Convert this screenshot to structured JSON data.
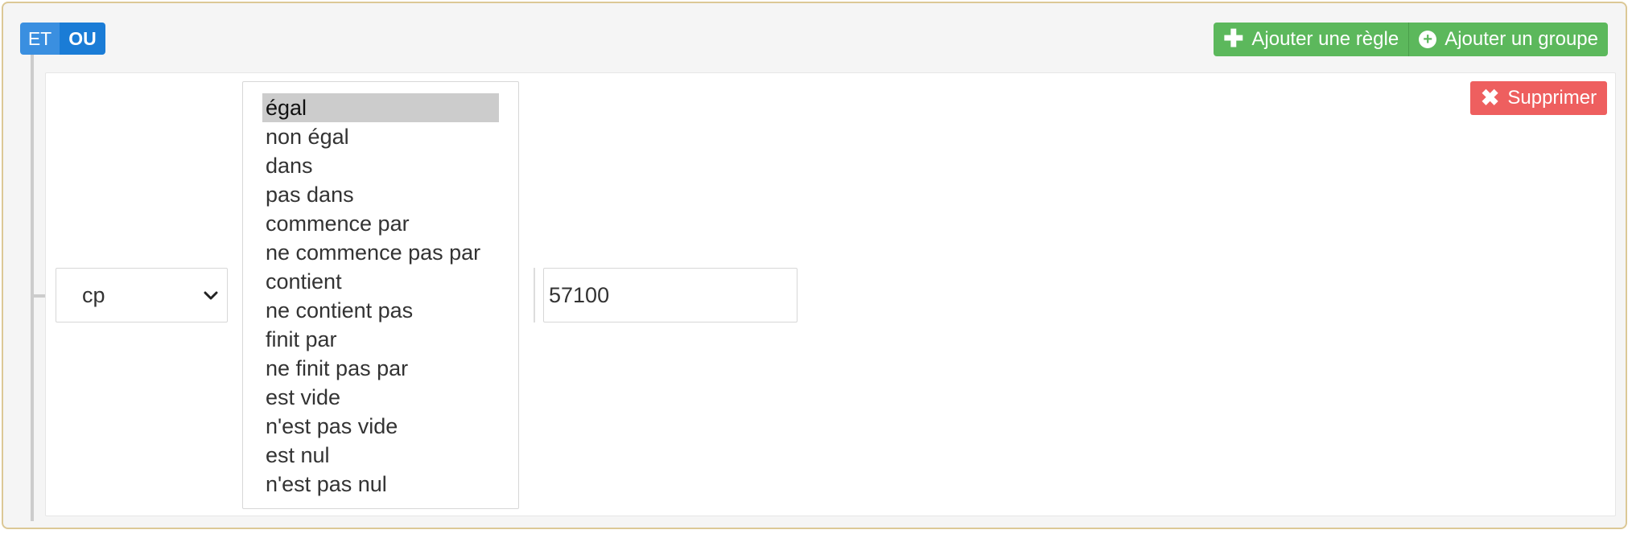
{
  "conditions": {
    "and_label": "ET",
    "or_label": "OU",
    "active": "OU"
  },
  "group_actions": {
    "add_rule_label": "Ajouter une règle",
    "add_group_label": "Ajouter un groupe"
  },
  "rule": {
    "delete_label": "Supprimer",
    "filter": {
      "selected": "cp"
    },
    "operator": {
      "selected": "égal",
      "options": [
        "égal",
        "non égal",
        "dans",
        "pas dans",
        "commence par",
        "ne commence pas par",
        "contient",
        "ne contient pas",
        "finit par",
        "ne finit pas par",
        "est vide",
        "n'est pas vide",
        "est nul",
        "n'est pas nul"
      ]
    },
    "value": "57100"
  },
  "icons": {
    "add_rule": "plus-icon",
    "add_group": "circle-plus-icon",
    "delete": "x-icon",
    "filter_dropdown": "chevron-down-icon"
  },
  "colors": {
    "group_border": "#dcc896",
    "condition_active": "#1a7cd6",
    "add_buttons": "#5cb85c",
    "delete_button": "#ee5f5f"
  }
}
